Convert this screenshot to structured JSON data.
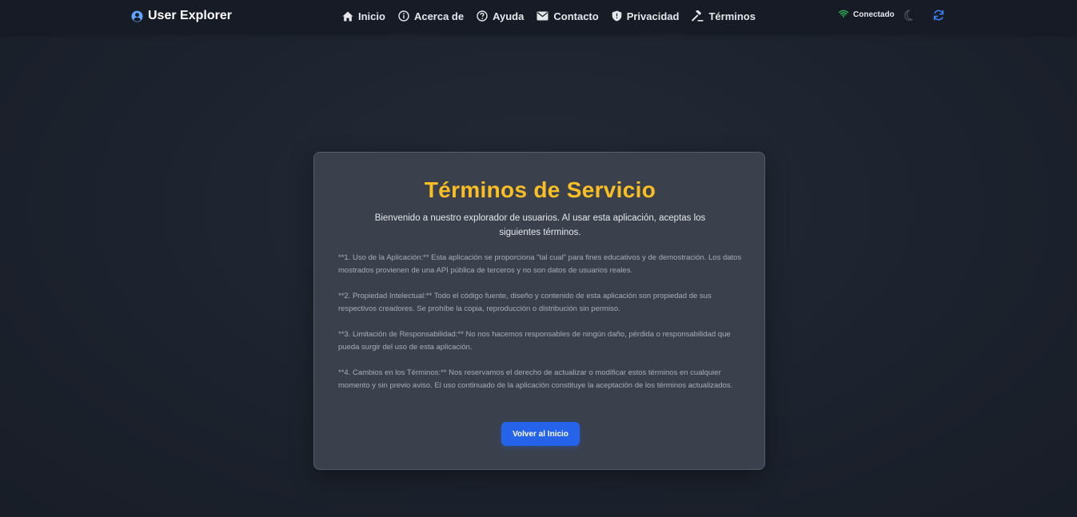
{
  "brand": {
    "title": "User Explorer",
    "icon": "user-circle-icon"
  },
  "nav": {
    "items": [
      {
        "label": "Inicio",
        "icon": "home-icon"
      },
      {
        "label": "Acerca de",
        "icon": "info-icon"
      },
      {
        "label": "Ayuda",
        "icon": "help-icon"
      },
      {
        "label": "Contacto",
        "icon": "mail-icon"
      },
      {
        "label": "Privacidad",
        "icon": "shield-icon"
      },
      {
        "label": "Términos",
        "icon": "gavel-icon"
      }
    ]
  },
  "status": {
    "label": "Conectado",
    "icon": "wifi-icon",
    "color": "#22c55e"
  },
  "actions": {
    "theme_icon": "moon-icon",
    "refresh_icon": "refresh-icon",
    "accent": "#3b82f6"
  },
  "card": {
    "title": "Términos de Servicio",
    "title_color": "#fbbf24",
    "intro": "Bienvenido a nuestro explorador de usuarios. Al usar esta aplicación, aceptas los siguientes términos.",
    "terms": [
      "**1. Uso de la Aplicación:** Esta aplicación se proporciona \"tal cual\" para fines educativos y de demostración. Los datos mostrados provienen de una API pública de terceros y no son datos de usuarios reales.",
      "**2. Propiedad Intelectual:** Todo el código fuente, diseño y contenido de esta aplicación son propiedad de sus respectivos creadores. Se prohíbe la copia, reproducción o distribución sin permiso.",
      "**3. Limitación de Responsabilidad:** No nos hacemos responsables de ningún daño, pérdida o responsabilidad que pueda surgir del uso de esta aplicación.",
      "**4. Cambios en los Términos:** Nos reservamos el derecho de actualizar o modificar estos términos en cualquier momento y sin previo aviso. El uso continuado de la aplicación constituye la aceptación de los términos actualizados."
    ],
    "button_label": "Volver al Inicio",
    "button_color": "#2563eb"
  }
}
